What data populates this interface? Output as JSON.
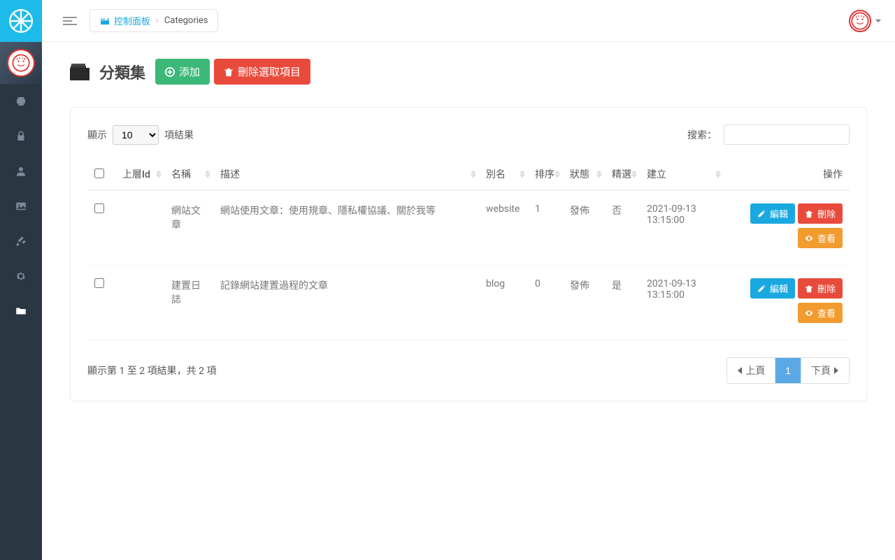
{
  "breadcrumb": {
    "home": "控制面板",
    "current": "Categories"
  },
  "page": {
    "title": "分類集",
    "add_label": "添加",
    "delete_selected_label": "刪除選取項目"
  },
  "datatable": {
    "show_prefix": "顯示",
    "show_value": "10",
    "show_suffix": "項結果",
    "search_label": "搜索：",
    "search_value": "",
    "columns": {
      "parent": "上層Id",
      "name": "名稱",
      "desc": "描述",
      "alias": "別名",
      "sort": "排序",
      "status": "狀態",
      "featured": "精選",
      "created": "建立",
      "actions": "操作"
    },
    "rows": [
      {
        "parent": "",
        "name": "網站文章",
        "desc": "網站使用文章：使用規章、隱私權協議、關於我等",
        "alias": "website",
        "sort": "1",
        "status": "發佈",
        "featured": "否",
        "created": "2021-09-13 13:15:00"
      },
      {
        "parent": "",
        "name": "建置日誌",
        "desc": "記錄網站建置過程的文章",
        "alias": "blog",
        "sort": "0",
        "status": "發佈",
        "featured": "是",
        "created": "2021-09-13 13:15:00"
      }
    ],
    "row_actions": {
      "edit": "編輯",
      "delete": "刪除",
      "view": "查看"
    },
    "info": "顯示第 1 至 2 項結果，共 2 項",
    "pager": {
      "prev": "上頁",
      "next": "下頁",
      "current": "1"
    }
  }
}
